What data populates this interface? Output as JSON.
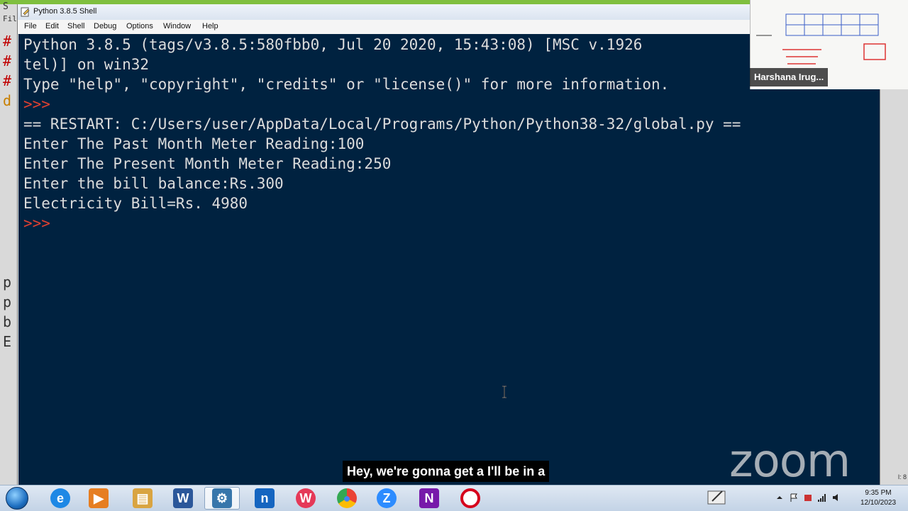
{
  "window": {
    "title": "Python 3.8.5 Shell",
    "menu": [
      "File",
      "Edit",
      "Shell",
      "Debug",
      "Options",
      "Window",
      "Help"
    ]
  },
  "shell": {
    "lines": [
      {
        "text": "Python 3.8.5 (tags/v3.8.5:580fbb0, Jul 20 2020, 15:43:08) [MSC v.1926",
        "kind": "out"
      },
      {
        "text": "tel)] on win32",
        "kind": "out"
      },
      {
        "text": "Type \"help\", \"copyright\", \"credits\" or \"license()\" for more information.",
        "kind": "out"
      },
      {
        "text": ">>> ",
        "kind": "prompt"
      },
      {
        "text": "== RESTART: C:/Users/user/AppData/Local/Programs/Python/Python38-32/global.py ==",
        "kind": "out"
      },
      {
        "text": "Enter The Past Month Meter Reading:100",
        "kind": "out"
      },
      {
        "text": "Enter The Present Month Meter Reading:250",
        "kind": "out"
      },
      {
        "text": "Enter the bill balance:Rs.300",
        "kind": "out"
      },
      {
        "text": "Electricity Bill=Rs. 4980",
        "kind": "out"
      },
      {
        "text": ">>> ",
        "kind": "prompt"
      }
    ]
  },
  "background_window": {
    "top_chars": [
      "S",
      "Fil"
    ],
    "left_chars": [
      "#",
      "#",
      "#",
      "d",
      "p",
      "p",
      "b",
      "E"
    ]
  },
  "frame_right_label": "l: 8",
  "participant": {
    "name": "Harshana Irug..."
  },
  "watermark": "zoom",
  "caption": "Hey, we're gonna get a I'll be in a",
  "taskbar": {
    "apps": [
      {
        "name": "internet-explorer",
        "glyph": "e",
        "color": "#1e88e5"
      },
      {
        "name": "media-player",
        "glyph": "▶",
        "color": "#e67e22"
      },
      {
        "name": "file-explorer",
        "glyph": "▤",
        "color": "#d9a441"
      },
      {
        "name": "word",
        "glyph": "W",
        "color": "#2b579a"
      },
      {
        "name": "python-idle",
        "glyph": "⚙",
        "color": "#3776ab",
        "active": true
      },
      {
        "name": "notion-like",
        "glyph": "n",
        "color": "#1565c0"
      },
      {
        "name": "wps",
        "glyph": "W",
        "color": "#e53958"
      },
      {
        "name": "chrome",
        "glyph": "●",
        "color": "#34a853"
      },
      {
        "name": "zoom",
        "glyph": "Z",
        "color": "#2d8cff"
      },
      {
        "name": "onenote",
        "glyph": "N",
        "color": "#7719aa"
      },
      {
        "name": "opera",
        "glyph": "O",
        "color": "#d6001c"
      }
    ],
    "clock": {
      "time": "9:35 PM",
      "date": "12/10/2023"
    }
  }
}
